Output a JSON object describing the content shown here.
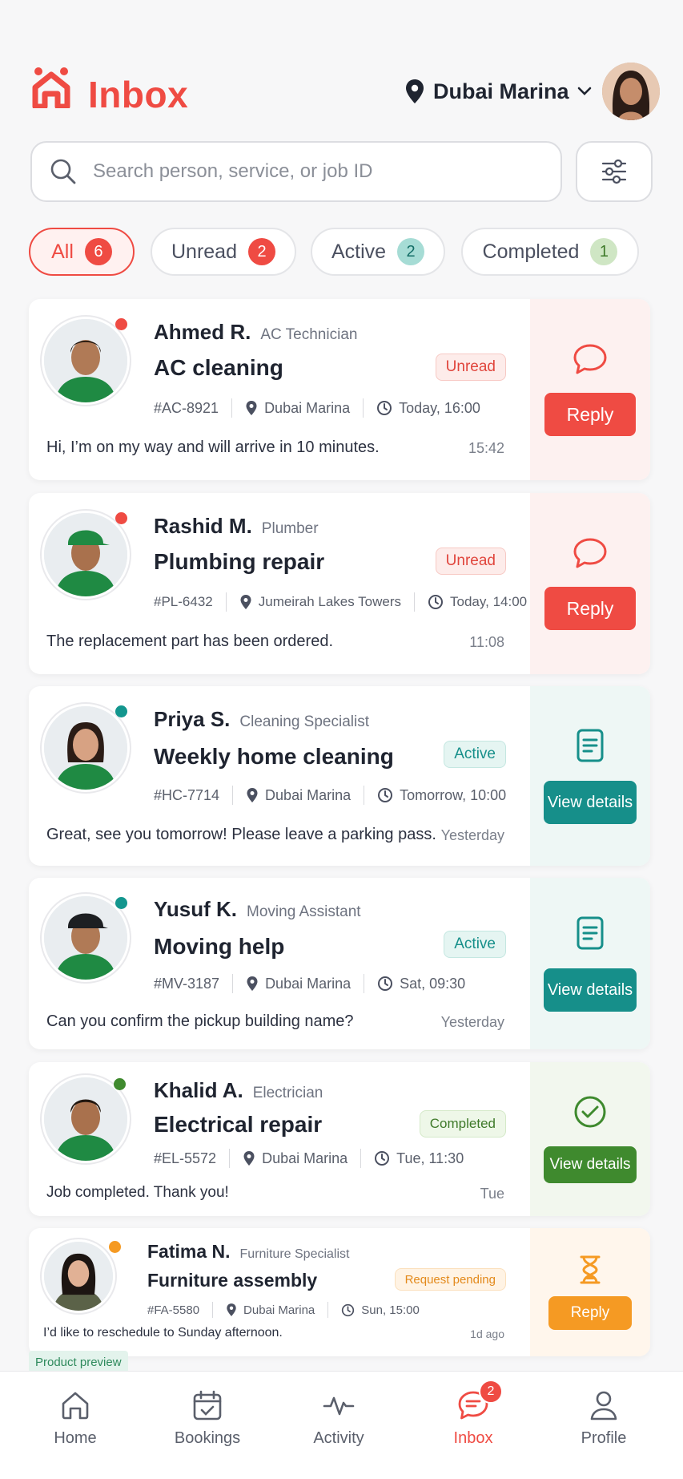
{
  "header": {
    "title": "Inbox",
    "location": "Dubai Marina"
  },
  "search": {
    "placeholder": "Search person, service, or job ID"
  },
  "filters": [
    {
      "label": "All",
      "count": "6"
    },
    {
      "label": "Unread",
      "count": "2"
    },
    {
      "label": "Active",
      "count": "2"
    },
    {
      "label": "Completed",
      "count": "1"
    }
  ],
  "colors": {
    "accent": "#ef4b43",
    "teal": "#168f8a",
    "green": "#3f8a2e",
    "orange": "#f59a23"
  },
  "conversations": [
    {
      "name": "Ahmed R.",
      "role": "AC Technician",
      "service": "AC cleaning",
      "status": "Unread",
      "job_id": "#AC-8921",
      "location": "Dubai Marina",
      "schedule": "Today, 16:00",
      "message": "Hi, I’m on my way and will arrive in 10 minutes.",
      "time": "15:42",
      "action": "Reply",
      "action_icon": "chat-bubble-icon"
    },
    {
      "name": "Rashid M.",
      "role": "Plumber",
      "service": "Plumbing repair",
      "status": "Unread",
      "job_id": "#PL-6432",
      "location": "Jumeirah Lakes Towers",
      "schedule": "Today, 14:00",
      "message": "The replacement part has been ordered.",
      "time": "11:08",
      "action": "Reply",
      "action_icon": "chat-bubble-icon"
    },
    {
      "name": "Priya S.",
      "role": "Cleaning Specialist",
      "service": "Weekly home cleaning",
      "status": "Active",
      "job_id": "#HC-7714",
      "location": "Dubai Marina",
      "schedule": "Tomorrow, 10:00",
      "message": "Great, see you tomorrow! Please leave a parking pass.",
      "time": "Yesterday",
      "action": "View details",
      "action_icon": "document-icon"
    },
    {
      "name": "Yusuf K.",
      "role": "Moving Assistant",
      "service": "Moving help",
      "status": "Active",
      "job_id": "#MV-3187",
      "location": "Dubai Marina",
      "schedule": "Sat, 09:30",
      "message": "Can you confirm the pickup building name?",
      "time": "Yesterday",
      "action": "View details",
      "action_icon": "document-icon"
    },
    {
      "name": "Khalid A.",
      "role": "Electrician",
      "service": "Electrical repair",
      "status": "Completed",
      "job_id": "#EL-5572",
      "location": "Dubai Marina",
      "schedule": "Tue, 11:30",
      "message": "Job completed. Thank you!",
      "time": "Tue",
      "action": "View details",
      "action_icon": "check-circle-icon"
    },
    {
      "name": "Fatima N.",
      "role": "Furniture Specialist",
      "service": "Furniture assembly",
      "status": "Request pending",
      "job_id": "#FA-5580",
      "location": "Dubai Marina",
      "schedule": "Sun, 15:00",
      "message": "I’d like to reschedule to Sunday afternoon.",
      "time": "1d ago",
      "action": "Reply",
      "action_icon": "hourglass-icon"
    }
  ],
  "preview_label": "Product preview",
  "bottom_nav": [
    {
      "label": "Home",
      "icon": "home-icon"
    },
    {
      "label": "Bookings",
      "icon": "calendar-check-icon"
    },
    {
      "label": "Activity",
      "icon": "activity-pulse-icon"
    },
    {
      "label": "Inbox",
      "icon": "chat-icon",
      "badge": "2"
    },
    {
      "label": "Profile",
      "icon": "person-icon"
    }
  ]
}
